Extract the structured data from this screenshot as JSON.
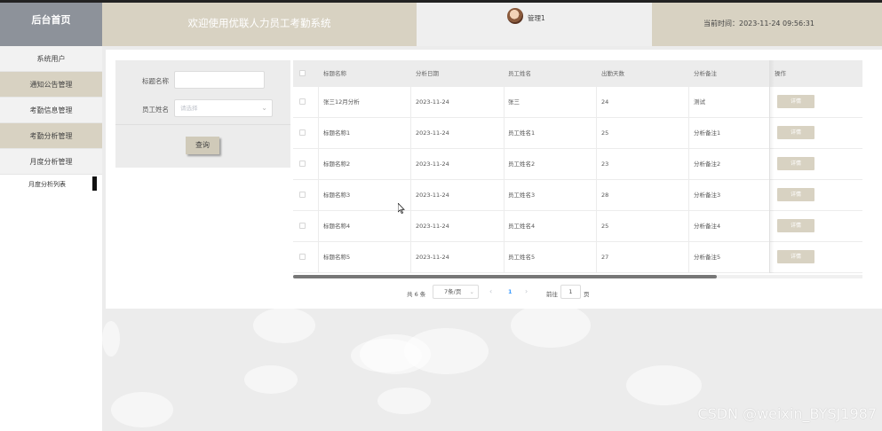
{
  "header": {
    "brand": "后台首页",
    "title": "欢迎使用优联人力员工考勤系统",
    "user": "管理1",
    "time_label": "当前时间：",
    "time_value": "2023-11-24 09:56:31"
  },
  "sidebar": {
    "items": [
      {
        "label": "系统用户"
      },
      {
        "label": "通知公告管理"
      },
      {
        "label": "考勤信息管理"
      },
      {
        "label": "考勤分析管理"
      },
      {
        "label": "月度分析管理"
      }
    ],
    "submenu": "月度分析列表"
  },
  "search": {
    "title_label": "标题名称",
    "title_value": "",
    "employee_label": "员工姓名",
    "employee_placeholder": "请选择",
    "query_button": "查询"
  },
  "table": {
    "headers": [
      "标题名称",
      "分析日期",
      "员工姓名",
      "出勤天数",
      "分析备注",
      "操作"
    ],
    "rows": [
      {
        "title": "张三12月分析",
        "date": "2023-11-24",
        "name": "张三",
        "days": "24",
        "note": "测试",
        "action": "详情"
      },
      {
        "title": "标题名称1",
        "date": "2023-11-24",
        "name": "员工姓名1",
        "days": "25",
        "note": "分析备注1",
        "action": "详情"
      },
      {
        "title": "标题名称2",
        "date": "2023-11-24",
        "name": "员工姓名2",
        "days": "23",
        "note": "分析备注2",
        "action": "详情"
      },
      {
        "title": "标题名称3",
        "date": "2023-11-24",
        "name": "员工姓名3",
        "days": "28",
        "note": "分析备注3",
        "action": "详情"
      },
      {
        "title": "标题名称4",
        "date": "2023-11-24",
        "name": "员工姓名4",
        "days": "25",
        "note": "分析备注4",
        "action": "详情"
      },
      {
        "title": "标题名称5",
        "date": "2023-11-24",
        "name": "员工姓名5",
        "days": "27",
        "note": "分析备注5",
        "action": "详情"
      }
    ]
  },
  "pagination": {
    "total": "共 6 条",
    "page_size": "7条/页",
    "current_page": "1",
    "goto_label": "前往",
    "goto_value": "1",
    "goto_unit": "页"
  },
  "watermark": "CSDN @weixin_BYSJ1987",
  "colors": {
    "accent": "#d8d2c2",
    "brand_bg": "#8d929a",
    "page_active": "#409eff"
  }
}
